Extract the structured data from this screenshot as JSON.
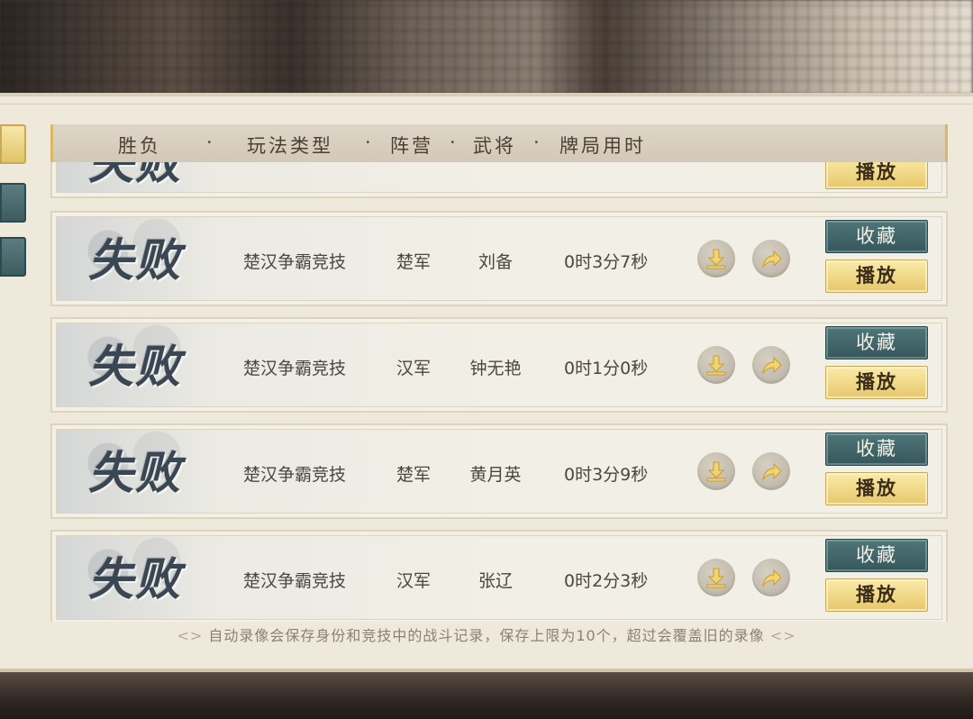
{
  "header": {
    "col_result": "胜负",
    "col_mode": "玩法类型",
    "col_camp": "阵营",
    "col_general": "武将",
    "col_time": "牌局用时",
    "separator": "·"
  },
  "partial_row": {
    "result": "失败",
    "play_label": "播放"
  },
  "records": [
    {
      "result": "失败",
      "mode": "楚汉争霸竞技",
      "camp": "楚军",
      "general": "刘备",
      "time": "0时3分7秒",
      "fav_label": "收藏",
      "play_label": "播放"
    },
    {
      "result": "失败",
      "mode": "楚汉争霸竞技",
      "camp": "汉军",
      "general": "钟无艳",
      "time": "0时1分0秒",
      "fav_label": "收藏",
      "play_label": "播放"
    },
    {
      "result": "失败",
      "mode": "楚汉争霸竞技",
      "camp": "楚军",
      "general": "黄月英",
      "time": "0时3分9秒",
      "fav_label": "收藏",
      "play_label": "播放"
    },
    {
      "result": "失败",
      "mode": "楚汉争霸竞技",
      "camp": "汉军",
      "general": "张辽",
      "time": "0时2分3秒",
      "fav_label": "收藏",
      "play_label": "播放"
    }
  ],
  "footer": {
    "note": "自动录像会保存身份和竞技中的战斗记录，保存上限为10个，超过会覆盖旧的录像",
    "ornament_left": "<>",
    "ornament_right": "<>"
  },
  "icons": {
    "download": "download-icon",
    "share": "share-arrow-icon"
  },
  "colors": {
    "fav_button": "#3f6366",
    "play_button": "#f0d88a",
    "result_text": "#3a4752",
    "panel_bg": "#efe9dc"
  }
}
